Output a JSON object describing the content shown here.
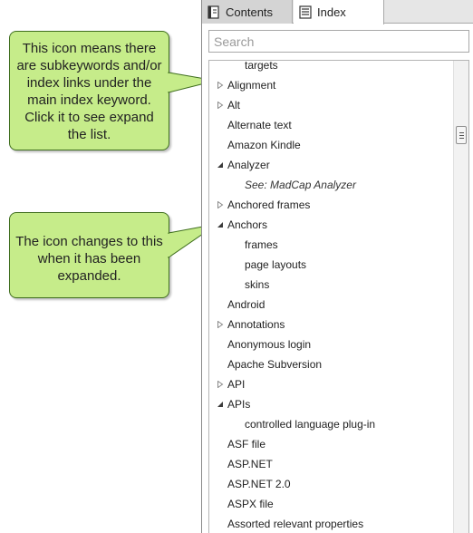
{
  "callouts": {
    "collapsed_note": "This icon means there are subkeywords and/or index links under the main index keyword. Click it to see expand the list.",
    "expanded_note": "The icon changes to this when it has been expanded."
  },
  "tabs": [
    {
      "label": "Contents",
      "icon": "book-icon",
      "active": false
    },
    {
      "label": "Index",
      "icon": "index-icon",
      "active": true
    }
  ],
  "search": {
    "placeholder": "Search",
    "value": ""
  },
  "index_entries": [
    {
      "label": "targets",
      "level": 1,
      "toggle": "none"
    },
    {
      "label": "Alignment",
      "level": 0,
      "toggle": "collapsed"
    },
    {
      "label": "Alt",
      "level": 0,
      "toggle": "collapsed"
    },
    {
      "label": "Alternate text",
      "level": 0,
      "toggle": "none"
    },
    {
      "label": "Amazon Kindle",
      "level": 0,
      "toggle": "none"
    },
    {
      "label": "Analyzer",
      "level": 0,
      "toggle": "expanded"
    },
    {
      "label": "See: MadCap Analyzer",
      "level": 1,
      "toggle": "none",
      "see_also": true
    },
    {
      "label": "Anchored frames",
      "level": 0,
      "toggle": "collapsed"
    },
    {
      "label": "Anchors",
      "level": 0,
      "toggle": "expanded"
    },
    {
      "label": "frames",
      "level": 1,
      "toggle": "none"
    },
    {
      "label": "page layouts",
      "level": 1,
      "toggle": "none"
    },
    {
      "label": "skins",
      "level": 1,
      "toggle": "none"
    },
    {
      "label": "Android",
      "level": 0,
      "toggle": "none"
    },
    {
      "label": "Annotations",
      "level": 0,
      "toggle": "collapsed"
    },
    {
      "label": "Anonymous login",
      "level": 0,
      "toggle": "none"
    },
    {
      "label": "Apache Subversion",
      "level": 0,
      "toggle": "none"
    },
    {
      "label": "API",
      "level": 0,
      "toggle": "collapsed"
    },
    {
      "label": "APIs",
      "level": 0,
      "toggle": "expanded"
    },
    {
      "label": "controlled language plug-in",
      "level": 1,
      "toggle": "none"
    },
    {
      "label": "ASF file",
      "level": 0,
      "toggle": "none"
    },
    {
      "label": "ASP.NET",
      "level": 0,
      "toggle": "none"
    },
    {
      "label": "ASP.NET 2.0",
      "level": 0,
      "toggle": "none"
    },
    {
      "label": "ASPX file",
      "level": 0,
      "toggle": "none"
    },
    {
      "label": "Assorted relevant properties",
      "level": 0,
      "toggle": "none"
    }
  ],
  "colors": {
    "callout_fill": "#c6ec8a",
    "callout_border": "#3f6e1e",
    "tabbar_bg": "#e6e6e6"
  }
}
